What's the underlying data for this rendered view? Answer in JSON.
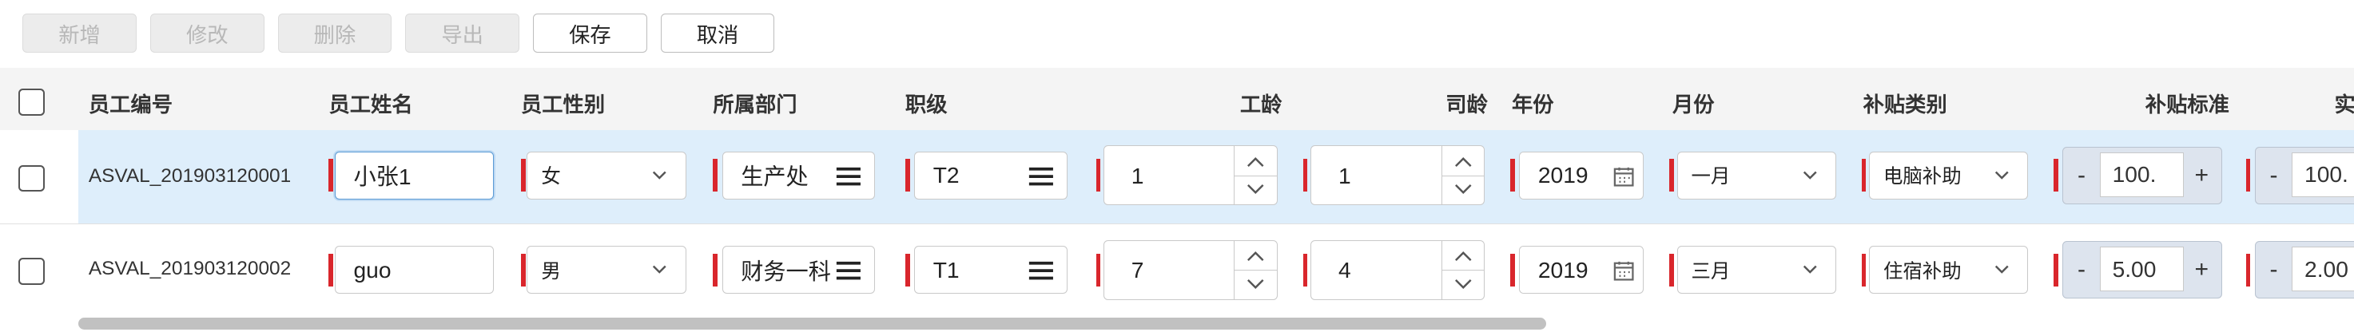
{
  "toolbar": {
    "add": "新增",
    "edit": "修改",
    "delete": "删除",
    "export": "导出",
    "save": "保存",
    "cancel": "取消"
  },
  "columns": {
    "emp_no": "员工编号",
    "emp_name": "员工姓名",
    "gender": "员工性别",
    "dept": "所属部门",
    "level": "职级",
    "work_years": "工龄",
    "company_years": "司龄",
    "year": "年份",
    "month": "月份",
    "subsidy_type": "补贴类别",
    "subsidy_std": "补贴标准",
    "actual": "实"
  },
  "rows": [
    {
      "emp_no": "ASVAL_201903120001",
      "emp_name": "小张1",
      "gender": "女",
      "dept": "生产处",
      "level": "T2",
      "work_years": "1",
      "company_years": "1",
      "year": "2019",
      "month": "一月",
      "subsidy_type": "电脑补助",
      "subsidy_std": "100.",
      "actual": "100."
    },
    {
      "emp_no": "ASVAL_201903120002",
      "emp_name": "guo",
      "gender": "男",
      "dept": "财务一科",
      "level": "T1",
      "work_years": "7",
      "company_years": "4",
      "year": "2019",
      "month": "三月",
      "subsidy_type": "住宿补助",
      "subsidy_std": "5.00",
      "actual": "2.00"
    }
  ],
  "stepper": {
    "minus": "-",
    "plus": "+"
  },
  "colors": {
    "required_marker": "#d9262c",
    "row_highlight": "#deeefb",
    "focus_border": "#5b9bd5"
  }
}
